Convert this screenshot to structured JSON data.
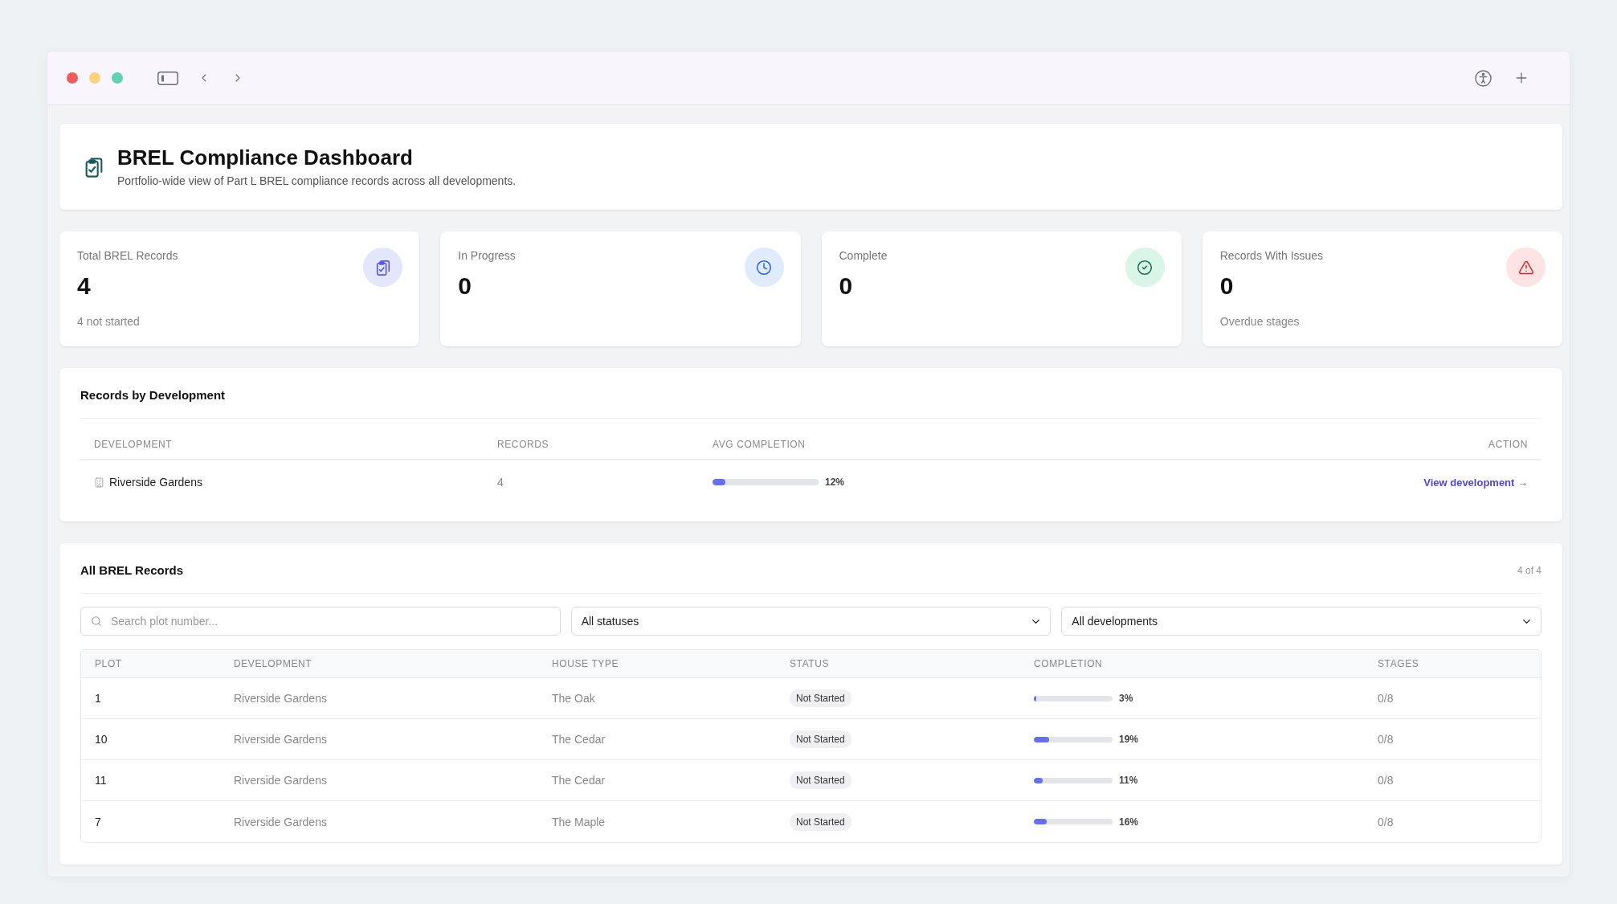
{
  "header": {
    "title": "BREL Compliance Dashboard",
    "subtitle": "Portfolio-wide view of Part L BREL compliance records across all developments."
  },
  "stats": [
    {
      "kind": "records",
      "label": "Total BREL Records",
      "value": "4",
      "note": "4 not started"
    },
    {
      "kind": "progress",
      "label": "In Progress",
      "value": "0"
    },
    {
      "kind": "complete",
      "label": "Complete",
      "value": "0"
    },
    {
      "kind": "issues",
      "label": "Records With Issues",
      "value": "0",
      "note": "Overdue stages"
    }
  ],
  "by_development": {
    "title": "Records by Development",
    "columns": [
      "DEVELOPMENT",
      "RECORDS",
      "AVG COMPLETION",
      "ACTION"
    ],
    "rows": [
      {
        "development": "Riverside Gardens",
        "records": "4",
        "level": 0.12,
        "completion": "12%",
        "action": "View development →"
      }
    ]
  },
  "records": {
    "title": "All BREL Records",
    "count": "4 of 4",
    "search": {
      "placeholder": "Search plot number..."
    },
    "filters": [
      {
        "value": "All statuses"
      },
      {
        "value": "All developments"
      }
    ],
    "columns": [
      "PLOT",
      "DEVELOPMENT",
      "HOUSE TYPE",
      "STATUS",
      "COMPLETION",
      "STAGES"
    ],
    "rows": [
      {
        "plot": "1",
        "development": "Riverside Gardens",
        "house_type": "The Oak",
        "status": "Not Started",
        "level": 0.03,
        "completion": "3%",
        "stages": "0/8"
      },
      {
        "plot": "10",
        "development": "Riverside Gardens",
        "house_type": "The Cedar",
        "status": "Not Started",
        "level": 0.19,
        "completion": "19%",
        "stages": "0/8"
      },
      {
        "plot": "11",
        "development": "Riverside Gardens",
        "house_type": "The Cedar",
        "status": "Not Started",
        "level": 0.11,
        "completion": "11%",
        "stages": "0/8"
      },
      {
        "plot": "7",
        "development": "Riverside Gardens",
        "house_type": "The Maple",
        "status": "Not Started",
        "level": 0.16,
        "completion": "16%",
        "stages": "0/8"
      }
    ]
  }
}
